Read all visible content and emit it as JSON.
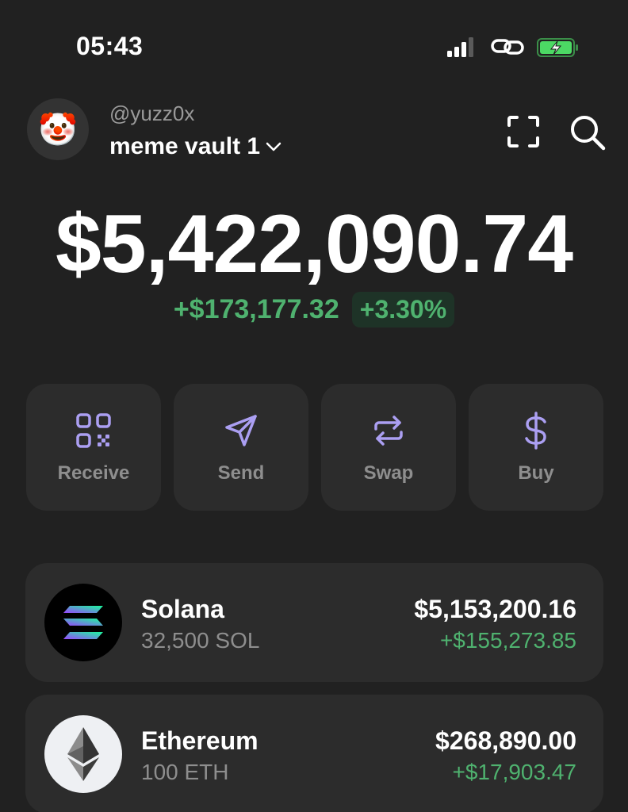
{
  "status_bar": {
    "time": "05:43"
  },
  "header": {
    "handle": "@yuzz0x",
    "wallet_name": "meme vault 1",
    "avatar_emoji": "🤡"
  },
  "balance": {
    "total": "$5,422,090.74",
    "change_amount": "+$173,177.32",
    "change_percent": "+3.30%"
  },
  "actions": [
    {
      "label": "Receive",
      "icon": "qr-code-icon"
    },
    {
      "label": "Send",
      "icon": "send-icon"
    },
    {
      "label": "Swap",
      "icon": "swap-icon"
    },
    {
      "label": "Buy",
      "icon": "dollar-icon"
    }
  ],
  "tokens": [
    {
      "name": "Solana",
      "amount": "32,500 SOL",
      "value": "$5,153,200.16",
      "change": "+$155,273.85",
      "icon": "solana-icon"
    },
    {
      "name": "Ethereum",
      "amount": "100 ETH",
      "value": "$268,890.00",
      "change": "+$17,903.47",
      "icon": "ethereum-icon"
    }
  ],
  "colors": {
    "background": "#212121",
    "card": "#2c2c2c",
    "accent_purple": "#ab9ff2",
    "positive_green": "#4fb26f",
    "battery_green": "#4cd964"
  }
}
